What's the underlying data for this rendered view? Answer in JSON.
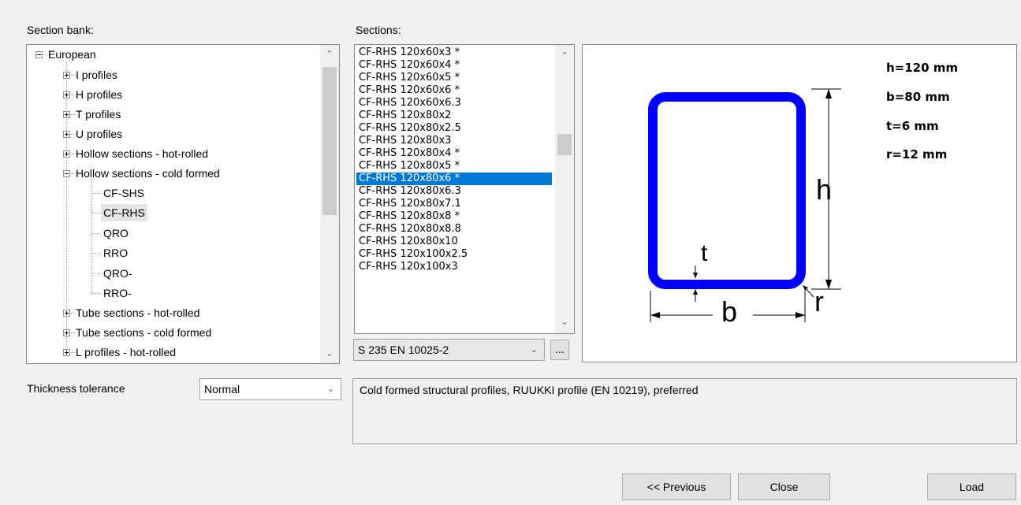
{
  "labels": {
    "section_bank": "Section bank:",
    "sections": "Sections:",
    "thickness_tolerance": "Thickness tolerance"
  },
  "tree": {
    "root": "European",
    "children": [
      "I profiles",
      "H profiles",
      "T profiles",
      "U profiles",
      "Hollow sections - hot-rolled",
      "Hollow sections - cold formed",
      "Tube sections - hot-rolled",
      "Tube sections - cold formed",
      "L profiles - hot-rolled"
    ],
    "cold_formed_children": [
      "CF-SHS",
      "CF-RHS",
      "QRO",
      "RRO",
      "QRO-",
      "RRO-"
    ],
    "selected": "CF-RHS"
  },
  "sections": {
    "items": [
      "CF-RHS 120x60x3 *",
      "CF-RHS 120x60x4 *",
      "CF-RHS 120x60x5 *",
      "CF-RHS 120x60x6 *",
      "CF-RHS 120x60x6.3",
      "CF-RHS 120x80x2",
      "CF-RHS 120x80x2.5",
      "CF-RHS 120x80x3",
      "CF-RHS 120x80x4 *",
      "CF-RHS 120x80x5 *",
      "CF-RHS 120x80x6 *",
      "CF-RHS 120x80x6.3",
      "CF-RHS 120x80x7.1",
      "CF-RHS 120x80x8 *",
      "CF-RHS 120x80x8.8",
      "CF-RHS 120x80x10",
      "CF-RHS 120x100x2.5",
      "CF-RHS 120x100x3"
    ],
    "selected_index": 10
  },
  "material": {
    "value": "S 235 EN 10025-2",
    "more_label": "..."
  },
  "tolerance": {
    "value": "Normal"
  },
  "preview": {
    "h_text": "h=120 mm",
    "b_text": "b=80 mm",
    "t_text": "t=6 mm",
    "r_text": "r=12 mm",
    "h_label": "h",
    "b_label": "b",
    "t_label": "t",
    "r_label": "r",
    "profile_color": "#0000ff"
  },
  "description": "Cold formed structural profiles, RUUKKI profile (EN 10219), preferred",
  "buttons": {
    "previous": "<< Previous",
    "close": "Close",
    "load": "Load"
  }
}
